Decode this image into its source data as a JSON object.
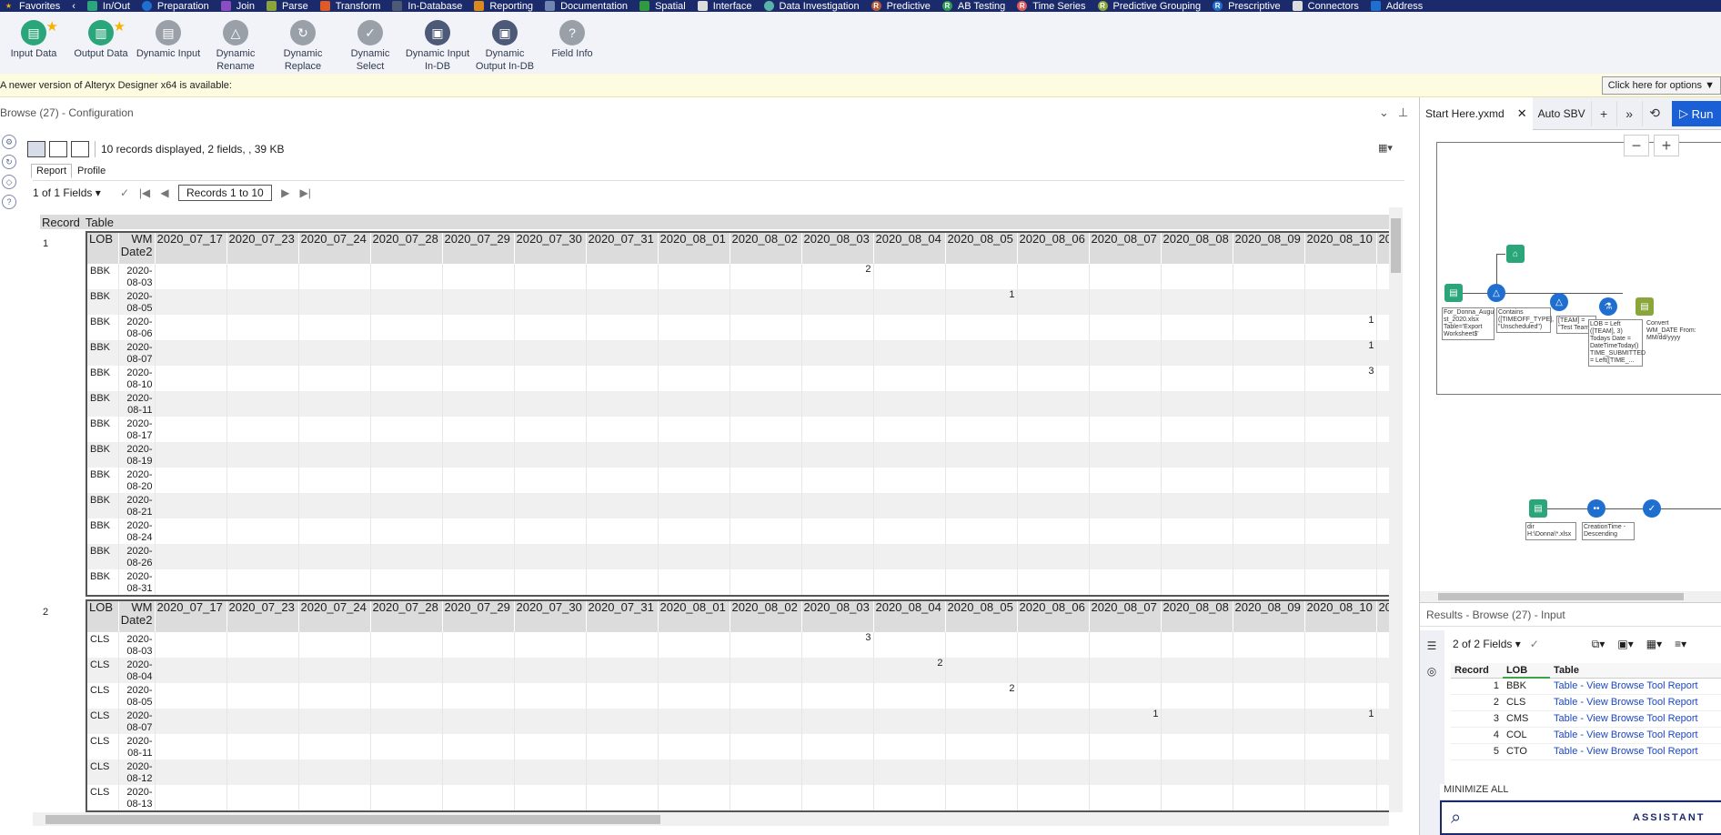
{
  "categories": [
    {
      "label": "Favorites",
      "color": "#f4b400",
      "icon": "star-icon",
      "glyph": "★"
    },
    {
      "label": "In/Out",
      "color": "#2aa67a",
      "icon": "book-icon",
      "glyph": ""
    },
    {
      "label": "Preparation",
      "color": "#1f6fd0",
      "icon": "circle-icon",
      "glyph": ""
    },
    {
      "label": "Join",
      "color": "#8b4ec2",
      "icon": "square-icon",
      "glyph": ""
    },
    {
      "label": "Parse",
      "color": "#8aa63a",
      "icon": "hexagon-icon",
      "glyph": ""
    },
    {
      "label": "Transform",
      "color": "#e05a28",
      "icon": "square-icon",
      "glyph": ""
    },
    {
      "label": "In-Database",
      "color": "#4c5a78",
      "icon": "database-icon",
      "glyph": ""
    },
    {
      "label": "Reporting",
      "color": "#d88a1e",
      "icon": "document-icon",
      "glyph": ""
    },
    {
      "label": "Documentation",
      "color": "#6e86b0",
      "icon": "cloud-icon",
      "glyph": ""
    },
    {
      "label": "Spatial",
      "color": "#2f9a3e",
      "icon": "globe-icon",
      "glyph": ""
    },
    {
      "label": "Interface",
      "color": "#dddddd",
      "icon": "diamond-icon",
      "glyph": ""
    },
    {
      "label": "Data Investigation",
      "color": "#59b3a8",
      "icon": "circle-icon",
      "glyph": ""
    },
    {
      "label": "Predictive",
      "color": "#b25b3c",
      "icon": "r-icon",
      "glyph": "R"
    },
    {
      "label": "AB Testing",
      "color": "#2e9c52",
      "icon": "r-icon",
      "glyph": "R"
    },
    {
      "label": "Time Series",
      "color": "#e05a5a",
      "icon": "r-icon",
      "glyph": "R"
    },
    {
      "label": "Predictive Grouping",
      "color": "#8aa63a",
      "icon": "r-icon",
      "glyph": "R"
    },
    {
      "label": "Prescriptive",
      "color": "#1f6fd0",
      "icon": "r-icon",
      "glyph": "R"
    },
    {
      "label": "Connectors",
      "color": "#dddddd",
      "icon": "cloud-icon",
      "glyph": ""
    },
    {
      "label": "Address",
      "color": "#1f6fd0",
      "icon": "square-icon",
      "glyph": ""
    }
  ],
  "tools": [
    {
      "label": "Input Data",
      "name": "input-data-tool",
      "color": "#2aa67a",
      "glyph": "▤",
      "star": true
    },
    {
      "label": "Output Data",
      "name": "output-data-tool",
      "color": "#2aa67a",
      "glyph": "▥",
      "star": true
    },
    {
      "label": "Dynamic Input",
      "name": "dynamic-input-tool",
      "color": "#9aa0a8",
      "glyph": "▤",
      "star": false
    },
    {
      "label": "Dynamic Rename",
      "name": "dynamic-rename-tool",
      "color": "#9aa0a8",
      "glyph": "△",
      "star": false
    },
    {
      "label": "Dynamic Replace",
      "name": "dynamic-replace-tool",
      "color": "#9aa0a8",
      "glyph": "↻",
      "star": false
    },
    {
      "label": "Dynamic Select",
      "name": "dynamic-select-tool",
      "color": "#9aa0a8",
      "glyph": "✓",
      "star": false
    },
    {
      "label": "Dynamic Input In-DB",
      "name": "dynamic-input-indb-tool",
      "color": "#4c5a78",
      "glyph": "▣",
      "star": false
    },
    {
      "label": "Dynamic Output In-DB",
      "name": "dynamic-output-indb-tool",
      "color": "#4c5a78",
      "glyph": "▣",
      "star": false
    },
    {
      "label": "Field Info",
      "name": "field-info-tool",
      "color": "#9aa0a8",
      "glyph": "?",
      "star": false
    }
  ],
  "notice": {
    "text": "A newer version of Alteryx Designer x64 is available:",
    "button": "Click here for options ▼"
  },
  "config": {
    "title": "Browse (27) - Configuration",
    "info": "10 records displayed, 2 fields, , 39 KB",
    "tabs": [
      "Report",
      "Profile"
    ],
    "fields": "1 of 1 Fields",
    "records": "Records 1 to 10",
    "report_header": [
      "Record",
      "Table"
    ]
  },
  "date_columns": [
    "2020_07_17",
    "2020_07_23",
    "2020_07_24",
    "2020_07_28",
    "2020_07_29",
    "2020_07_30",
    "2020_07_31",
    "2020_08_01",
    "2020_08_02",
    "2020_08_03",
    "2020_08_04",
    "2020_08_05",
    "2020_08_06",
    "2020_08_07",
    "2020_08_08",
    "2020_08_09",
    "2020_08_10",
    "20"
  ],
  "lob_header": "LOB",
  "wm_header": "WM Date2",
  "records": [
    {
      "num": "1",
      "rows": [
        {
          "lob": "BBK",
          "date": "2020-08-03",
          "values": {
            "2020_08_03": "2"
          }
        },
        {
          "lob": "BBK",
          "date": "2020-08-05",
          "values": {
            "2020_08_05": "1"
          }
        },
        {
          "lob": "BBK",
          "date": "2020-08-06",
          "values": {
            "2020_08_10": "1"
          }
        },
        {
          "lob": "BBK",
          "date": "2020-08-07",
          "values": {
            "2020_08_10": "1"
          }
        },
        {
          "lob": "BBK",
          "date": "2020-08-10",
          "values": {
            "2020_08_10": "3"
          }
        },
        {
          "lob": "BBK",
          "date": "2020-08-11",
          "values": {}
        },
        {
          "lob": "BBK",
          "date": "2020-08-17",
          "values": {}
        },
        {
          "lob": "BBK",
          "date": "2020-08-19",
          "values": {}
        },
        {
          "lob": "BBK",
          "date": "2020-08-20",
          "values": {}
        },
        {
          "lob": "BBK",
          "date": "2020-08-21",
          "values": {}
        },
        {
          "lob": "BBK",
          "date": "2020-08-24",
          "values": {}
        },
        {
          "lob": "BBK",
          "date": "2020-08-26",
          "values": {}
        },
        {
          "lob": "BBK",
          "date": "2020-08-31",
          "values": {}
        }
      ]
    },
    {
      "num": "2",
      "rows": [
        {
          "lob": "CLS",
          "date": "2020-08-03",
          "values": {
            "2020_08_03": "3"
          }
        },
        {
          "lob": "CLS",
          "date": "2020-08-04",
          "values": {
            "2020_08_04": "2"
          }
        },
        {
          "lob": "CLS",
          "date": "2020-08-05",
          "values": {
            "2020_08_05": "2"
          }
        },
        {
          "lob": "CLS",
          "date": "2020-08-07",
          "values": {
            "2020_08_07": "1",
            "2020_08_10": "1"
          }
        },
        {
          "lob": "CLS",
          "date": "2020-08-11",
          "values": {}
        },
        {
          "lob": "CLS",
          "date": "2020-08-12",
          "values": {}
        },
        {
          "lob": "CLS",
          "date": "2020-08-13",
          "values": {}
        }
      ]
    }
  ],
  "right": {
    "tabs": [
      {
        "label": "Start Here.yxmd",
        "active": true,
        "close": "✕"
      },
      {
        "label": "Auto SBV",
        "active": false,
        "close": ""
      }
    ],
    "run_label": "Run",
    "zoom_out": "−",
    "zoom_in": "+",
    "canvas_labels": {
      "n1": "For_Donna_Augu st_2020.xlsx Table='Export Worksheet$'",
      "n2": "Contains ([TIMEOFF_TYPE], \"Unscheduled\")",
      "n3": "[TEAM] = \"Test Team\"",
      "n4": "LOB = Left ([TEAM], 3) Todays Date = DateTimeToday() TIME_SUBMITTED = Left([TIME_...",
      "n5": "Convert WM_DATE From: MM/dd/yyyy",
      "n6": "dir H:\\Donna\\*.xlsx",
      "n7": "CreationTime - Descending"
    },
    "results_title": "Results - Browse (27) - Input",
    "results_fields": "2 of 2 Fields",
    "results_headers": [
      "Record",
      "LOB",
      "Table"
    ],
    "results_rows": [
      {
        "n": "1",
        "lob": "BBK",
        "table": "Table - View Browse Tool Report"
      },
      {
        "n": "2",
        "lob": "CLS",
        "table": "Table - View Browse Tool Report"
      },
      {
        "n": "3",
        "lob": "CMS",
        "table": "Table - View Browse Tool Report"
      },
      {
        "n": "4",
        "lob": "COL",
        "table": "Table - View Browse Tool Report"
      },
      {
        "n": "5",
        "lob": "CTO",
        "table": "Table - View Browse Tool Report"
      }
    ],
    "minimize": "MINIMIZE ALL",
    "assistant": "ASSISTANT"
  }
}
